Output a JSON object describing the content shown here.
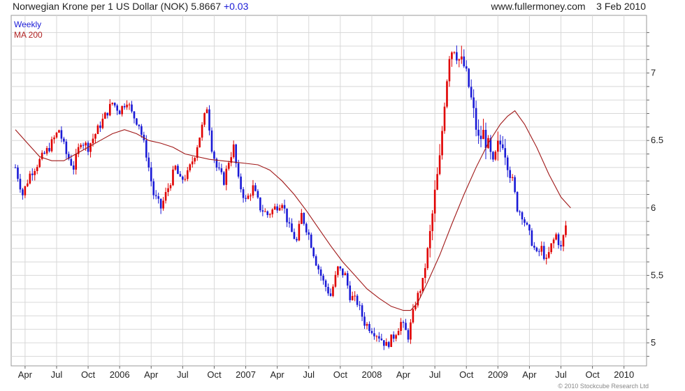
{
  "header": {
    "title": "Norwegian Krone per 1 US Dollar (NOK)",
    "last": "5.8667",
    "change": "+0.03",
    "site": "www.fullermoney.com",
    "date": "3 Feb 2010"
  },
  "legend": {
    "weekly": "Weekly",
    "ma": "MA 200"
  },
  "copyright": "© 2010 Stockcube Research Ltd",
  "colors": {
    "up": "#1a1ad6",
    "down": "#e00000",
    "ma": "#a01818",
    "grid": "#d8d8d8"
  },
  "chart_data": {
    "type": "candlestick",
    "xlabels": [
      "Apr",
      "Jul",
      "Oct",
      "2006",
      "Apr",
      "Jul",
      "Oct",
      "2007",
      "Apr",
      "Jul",
      "Oct",
      "2008",
      "Apr",
      "Jul",
      "Oct",
      "2009",
      "Apr",
      "Jul",
      "Oct",
      "2010"
    ],
    "xtick_weeks": [
      4,
      17,
      30,
      43,
      56,
      69,
      82,
      95,
      108,
      121,
      134,
      147,
      160,
      173,
      186,
      199,
      212,
      225,
      238,
      251
    ],
    "ylim": [
      4.88,
      7.33
    ],
    "yticks": [
      5,
      5.5,
      6,
      6.5,
      7
    ],
    "week_range": [
      0,
      258
    ],
    "weekly_close_anchors": [
      [
        0,
        6.3
      ],
      [
        3,
        6.1
      ],
      [
        6,
        6.25
      ],
      [
        10,
        6.35
      ],
      [
        14,
        6.45
      ],
      [
        18,
        6.58
      ],
      [
        21,
        6.4
      ],
      [
        24,
        6.3
      ],
      [
        27,
        6.5
      ],
      [
        30,
        6.45
      ],
      [
        33,
        6.55
      ],
      [
        36,
        6.65
      ],
      [
        40,
        6.78
      ],
      [
        43,
        6.72
      ],
      [
        46,
        6.8
      ],
      [
        48,
        6.7
      ],
      [
        51,
        6.62
      ],
      [
        54,
        6.4
      ],
      [
        57,
        6.1
      ],
      [
        60,
        6.0
      ],
      [
        63,
        6.15
      ],
      [
        66,
        6.3
      ],
      [
        68,
        6.2
      ],
      [
        71,
        6.25
      ],
      [
        74,
        6.4
      ],
      [
        77,
        6.6
      ],
      [
        79,
        6.75
      ],
      [
        81,
        6.45
      ],
      [
        83,
        6.3
      ],
      [
        86,
        6.2
      ],
      [
        88,
        6.35
      ],
      [
        90,
        6.45
      ],
      [
        92,
        6.2
      ],
      [
        95,
        6.05
      ],
      [
        98,
        6.15
      ],
      [
        101,
        6.0
      ],
      [
        104,
        5.95
      ],
      [
        107,
        6.0
      ],
      [
        110,
        6.05
      ],
      [
        113,
        5.85
      ],
      [
        116,
        5.75
      ],
      [
        118,
        5.95
      ],
      [
        121,
        5.8
      ],
      [
        124,
        5.6
      ],
      [
        127,
        5.45
      ],
      [
        130,
        5.35
      ],
      [
        133,
        5.55
      ],
      [
        136,
        5.5
      ],
      [
        138,
        5.35
      ],
      [
        141,
        5.3
      ],
      [
        144,
        5.15
      ],
      [
        147,
        5.1
      ],
      [
        150,
        5.05
      ],
      [
        153,
        4.98
      ],
      [
        156,
        5.05
      ],
      [
        159,
        5.15
      ],
      [
        162,
        5.05
      ],
      [
        165,
        5.3
      ],
      [
        168,
        5.45
      ],
      [
        171,
        5.8
      ],
      [
        173,
        6.1
      ],
      [
        175,
        6.35
      ],
      [
        177,
        6.8
      ],
      [
        179,
        7.15
      ],
      [
        181,
        7.2
      ],
      [
        183,
        7.1
      ],
      [
        185,
        7.05
      ],
      [
        187,
        6.9
      ],
      [
        189,
        6.7
      ],
      [
        191,
        6.5
      ],
      [
        193,
        6.55
      ],
      [
        195,
        6.45
      ],
      [
        197,
        6.3
      ],
      [
        199,
        6.45
      ],
      [
        201,
        6.5
      ],
      [
        203,
        6.35
      ],
      [
        205,
        6.2
      ],
      [
        207,
        6.0
      ],
      [
        209,
        5.95
      ],
      [
        211,
        5.85
      ],
      [
        213,
        5.75
      ],
      [
        215,
        5.65
      ],
      [
        217,
        5.7
      ],
      [
        219,
        5.6
      ],
      [
        221,
        5.72
      ],
      [
        223,
        5.8
      ],
      [
        225,
        5.7
      ],
      [
        227,
        5.87
      ]
    ],
    "ma_anchors": [
      [
        0,
        6.58
      ],
      [
        5,
        6.48
      ],
      [
        10,
        6.38
      ],
      [
        15,
        6.35
      ],
      [
        20,
        6.35
      ],
      [
        25,
        6.4
      ],
      [
        30,
        6.45
      ],
      [
        35,
        6.5
      ],
      [
        40,
        6.55
      ],
      [
        45,
        6.58
      ],
      [
        50,
        6.55
      ],
      [
        55,
        6.5
      ],
      [
        60,
        6.48
      ],
      [
        65,
        6.45
      ],
      [
        70,
        6.4
      ],
      [
        75,
        6.38
      ],
      [
        80,
        6.36
      ],
      [
        85,
        6.35
      ],
      [
        90,
        6.34
      ],
      [
        95,
        6.33
      ],
      [
        100,
        6.32
      ],
      [
        105,
        6.28
      ],
      [
        110,
        6.2
      ],
      [
        115,
        6.1
      ],
      [
        120,
        5.98
      ],
      [
        125,
        5.85
      ],
      [
        130,
        5.72
      ],
      [
        135,
        5.6
      ],
      [
        140,
        5.5
      ],
      [
        145,
        5.4
      ],
      [
        150,
        5.33
      ],
      [
        155,
        5.27
      ],
      [
        160,
        5.24
      ],
      [
        163,
        5.24
      ],
      [
        166,
        5.3
      ],
      [
        170,
        5.45
      ],
      [
        175,
        5.65
      ],
      [
        180,
        5.88
      ],
      [
        185,
        6.1
      ],
      [
        190,
        6.3
      ],
      [
        195,
        6.48
      ],
      [
        200,
        6.62
      ],
      [
        203,
        6.68
      ],
      [
        206,
        6.72
      ],
      [
        210,
        6.62
      ],
      [
        215,
        6.45
      ],
      [
        220,
        6.25
      ],
      [
        225,
        6.08
      ],
      [
        229,
        6.0
      ]
    ]
  }
}
